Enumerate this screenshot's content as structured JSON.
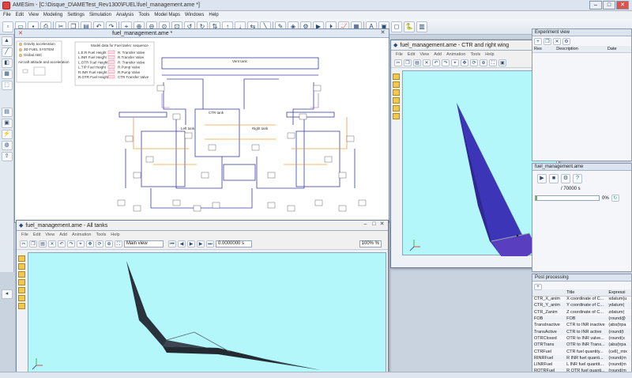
{
  "app": {
    "title": "AMESim - [C:\\Disque_D\\AMETest_Rev1300\\FUEL\\fuel_management.ame *]",
    "menu": [
      "File",
      "Edit",
      "View",
      "Modeling",
      "Settings",
      "Simulation",
      "Analysis",
      "Tools",
      "Model Maps",
      "Windows",
      "Help"
    ]
  },
  "sketch": {
    "title": "fuel_management.ame *",
    "legend": [
      "Gravity acceleration",
      "3D FUEL SYSTEM",
      "Global ABC",
      "Aircraft attitude and acceleration"
    ],
    "parameter_box_title": "Model data for Fuel tanks: sequence",
    "param_rows": [
      "L.E.R Fuel Height",
      "L.INR Fuel Height",
      "L.OTR Fuel Height",
      "L.TIP Fuel Height",
      "R.INR Fuel Height",
      "R.OTR Fuel Height"
    ],
    "param_values": [
      "R. Transfer Valve",
      "R.Transfer Valve",
      "R. Transfer Valve",
      "R.Pump Valve",
      "R.Pump Valve",
      "CTR Transfer Valve"
    ],
    "labels": [
      "Vent tank",
      "Left tank",
      "CTR tank",
      "Right tank",
      "Vent tank"
    ]
  },
  "win_ctr": {
    "title": "fuel_management.ame - CTR and right wing",
    "menu": [
      "File",
      "Edit",
      "View",
      "Add",
      "Animation",
      "Tools",
      "Help"
    ]
  },
  "win_all": {
    "title": "fuel_management.ame - All tanks",
    "menu": [
      "File",
      "Edit",
      "View",
      "Add",
      "Animation",
      "Tools",
      "Help"
    ],
    "view_select": "Main view",
    "time_value": "0.0000000 s",
    "zoom_select": "100% %"
  },
  "experiment": {
    "title": "Experiment view",
    "headers": [
      "Res",
      "Description",
      "Date"
    ]
  },
  "sim_panel": {
    "title": "fuel_management.ame",
    "time_label": "/ 70000 s",
    "progress_text": "0%",
    "progress_fraction": 0.02
  },
  "post": {
    "title": "Post processing",
    "headers": [
      "",
      "Title",
      "Expressi"
    ],
    "rows": [
      [
        "CTR_X_anim",
        "X coordinate of C...",
        "xdatum(u"
      ],
      [
        "CTR_Y_anim",
        "Y coordinate of C...",
        "ydatum("
      ],
      [
        "CTR_Zanim",
        "Z coordinate of C...",
        "zdatum("
      ],
      [
        "FOB",
        "FOB",
        "(round@"
      ],
      [
        "TransInactive",
        "CTR to INR inactive",
        "(abs(trpa"
      ],
      [
        "TransActive",
        "CTR to INR active",
        "(round(t"
      ],
      [
        "OTRClosed",
        "OTR to INR valve...",
        "(round(s"
      ],
      [
        "OTRTrans",
        "OTR to INR Trans...",
        "(abs(trpa"
      ],
      [
        "CTRFuel",
        "CTR fuel quantity...",
        "(cell(_mix"
      ],
      [
        "RINRFuel",
        "R INR fuel quanti...",
        "(round(m"
      ],
      [
        "LINRFuel",
        "L INR fuel quantit...",
        "(round(m"
      ],
      [
        "ROTRFuel",
        "R OTR fuel quanti...",
        "(round(m"
      ],
      [
        "LOTRFuel",
        "L OTR fuel quantit...",
        "(round(m"
      ],
      [
        "RtipFuel",
        "R tip fuel quantity",
        "(round(m"
      ]
    ]
  },
  "colors": {
    "viewport_bg": "#b3f7fb",
    "wing_ctr": "#3c35b8",
    "wing_all": "#3b4652",
    "schematic_blue": "#3a3fa8",
    "schematic_orange": "#e6a040"
  }
}
